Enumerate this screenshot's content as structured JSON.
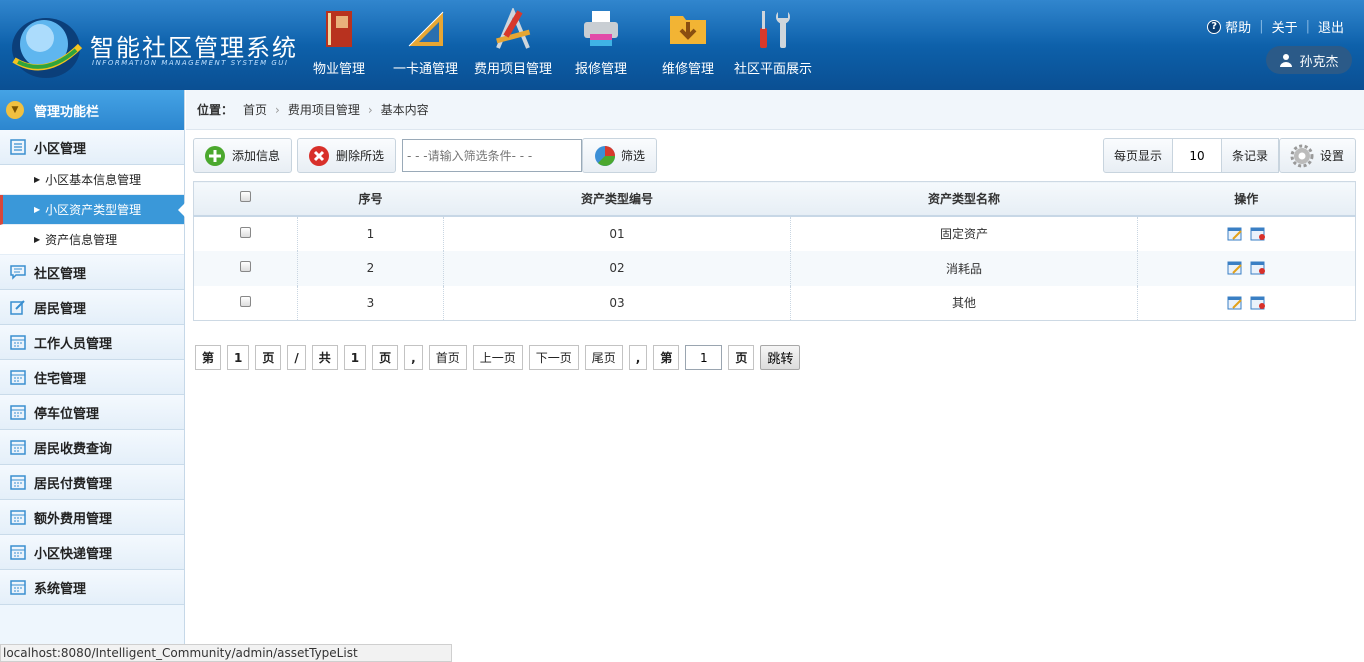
{
  "header": {
    "title": "智能社区管理系统",
    "subtitle": "INFORMATION MANAGEMENT SYSTEM GUI",
    "nav": [
      {
        "label": "物业管理",
        "icon": "book-icon"
      },
      {
        "label": "一卡通管理",
        "icon": "ruler-icon"
      },
      {
        "label": "费用项目管理",
        "icon": "drawing-tools-icon"
      },
      {
        "label": "报修管理",
        "icon": "printer-icon"
      },
      {
        "label": "维修管理",
        "icon": "folder-download-icon"
      },
      {
        "label": "社区平面展示",
        "icon": "wrench-screwdriver-icon"
      }
    ],
    "links": {
      "help": "帮助",
      "about": "关于",
      "logout": "退出"
    },
    "user": "孙克杰"
  },
  "sidebar": {
    "title": "管理功能栏",
    "menus": [
      {
        "label": "小区管理",
        "subs": [
          "小区基本信息管理",
          "小区资产类型管理",
          "资产信息管理"
        ]
      },
      {
        "label": "社区管理"
      },
      {
        "label": "居民管理"
      },
      {
        "label": "工作人员管理"
      },
      {
        "label": "住宅管理"
      },
      {
        "label": "停车位管理"
      },
      {
        "label": "居民收费查询"
      },
      {
        "label": "居民付费管理"
      },
      {
        "label": "额外费用管理"
      },
      {
        "label": "小区快递管理"
      },
      {
        "label": "系统管理"
      }
    ]
  },
  "breadcrumb": {
    "prefix": "位置：",
    "items": [
      "首页",
      "费用项目管理",
      "基本内容"
    ]
  },
  "toolbar": {
    "add": "添加信息",
    "delete": "删除所选",
    "filter_placeholder": "- - -请输入筛选条件- - -",
    "filter": "筛选",
    "per_page_label": "每页显示",
    "per_page": "10",
    "records": "条记录",
    "settings": "设置"
  },
  "table": {
    "headers": [
      "序号",
      "资产类型编号",
      "资产类型名称",
      "操作"
    ],
    "rows": [
      {
        "no": "1",
        "code": "01",
        "name": "固定资产"
      },
      {
        "no": "2",
        "code": "02",
        "name": "消耗品"
      },
      {
        "no": "3",
        "code": "03",
        "name": "其他"
      }
    ]
  },
  "pager": {
    "di": "第",
    "cur": "1",
    "ye": "页",
    "slash": "/",
    "gong": "共",
    "total": "1",
    "comma": ",",
    "first": "首页",
    "prev": "上一页",
    "next": "下一页",
    "last": "尾页",
    "goto": "1",
    "jump": "跳转"
  },
  "statusbar": "localhost:8080/Intelligent_Community/admin/assetTypeList",
  "colors": {
    "header": "#0d5fa8",
    "active": "#3a98d9",
    "accent": "#d6473b"
  }
}
